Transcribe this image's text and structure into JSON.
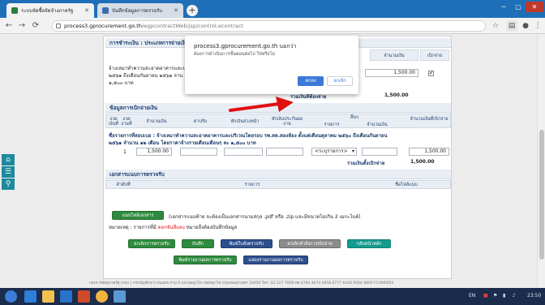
{
  "browser": {
    "tabs": [
      {
        "label": "ระบบจัดซื้อจัดจ้างภาครัฐ",
        "active": true
      },
      {
        "label": "บันทึกข้อมูลการตรวจรับ",
        "active": false
      }
    ],
    "url_host": "process3.gprocurement.go.th",
    "url_path": "/egpcontractWeb/jsp/control.econtract"
  },
  "page": {
    "top_section": {
      "title": "การชำระเงิน : ประเภทการจ่ายเงิน",
      "col_amount": "จำนวนเงิน",
      "col_select": "เบิกจ่าย",
      "row_text_1": "จ้างเหมาทำความสะอาดอาคารและบ",
      "row_text_2": "๒๕๖๑ ถึงเดือนกันยายน ๒๕๖๑ จาน",
      "row_text_3": "๑,๕๐๐ บาท",
      "row_amount": "1,500.00",
      "row_checked": "✔",
      "total_label": "รวมเงินที่ต้องจ่าย",
      "total_value": "1,500.00"
    },
    "disbursement": {
      "title": "ข้อมูลการเบิกจ่ายเงิน",
      "headers": {
        "period": "งวด เงินที่",
        "seq": "งวด งานที่",
        "amount": "จำนวนเงิน",
        "fine": "ค่าปรับ",
        "advance": "หักเงินล่วงหน้า",
        "retention": "หักเงินประกันผลงาน",
        "deduct": "อื่นๆ",
        "deduct_item": "รายการ",
        "deduct_amount": "จำนวนเงิน",
        "net": "จำนวนเงินที่เบิกจ่าย"
      },
      "desc_line_1": "ชื่อรายการที่สอบเบอ : จ้างเหมาทำความสะอาดอาคารและบริเวณโดยรอบ รพ.สต.สองห้อง ตั้งแต่เดือนตุลาคม ๒๕๖๐ ถึงเดือนกันยายน",
      "desc_line_2": "๒๕๖๑ จำนวน ๑๒ เดือน โดยราคาจ้างรายเดือนเดือนๆ ละ ๑,๕๐๐ บาท",
      "row_period": "1",
      "row_amount": "1,500.00",
      "row_select": "<ระบุรายการ>",
      "row_net": "1,500.00",
      "total_label": "รวมเงินตั้งเบิกจ่าย",
      "total_value": "1,500.00"
    },
    "attachments": {
      "title": "เอกสารแนบการตรวจรับ",
      "col_no": "ลำดับที่",
      "col_item": "รายการ",
      "col_file": "ชื่อไฟล์แนบ",
      "upload_button": "แนบไฟล์เอกสาร",
      "upload_note": "(เอกสารแนบท้าย จะต้องเป็นเอกสารนามสกุล .pdf หรือ .zip และมีขนาดไม่เกิน 2 เมกะไบต์)",
      "remark_prefix": "หมายเหตุ : รายการที่มี",
      "remark_red": "ดอกจันสีแดง",
      "remark_suffix": "หมายถึงต้องบันทึกข้อมูล"
    },
    "buttons": {
      "back": "ยกเลิกการตรวจรับ",
      "save": "บันทึก",
      "print_form": "พิมพ์ใบสั่งตรวจรับ",
      "cancel_disburse": "ยกเลิกคำสั่งการเบิกจ่าย",
      "return": "กลับหน้าหลัก",
      "print_report": "พิมพ์รายงานผลการตรวจรับ",
      "send_report": "แสดงรายงานผลการตรวจรับ"
    },
    "footer": "กองการพัสดุภาครัฐ (กพภ.) กรมบัญชีกลาง ถนนพระราม 6 แขวงพญาไท เขตพญาไท กรุงเทพมหานคร 10400 โทร. 02-127-7000 ต่อ 6784 4674 4958 6777 6438 6934 6800   FCON0003"
  },
  "dialog": {
    "host": "process3.gprocurement.go.th บอกว่า",
    "message": "ต้องการดำเนินการขั้นตอนต่อไป ใช่หรือไม่",
    "ok": "ตกลง",
    "cancel": "ยกเลิก"
  },
  "side_icons": [
    "home-icon",
    "grid-icon",
    "search-icon"
  ],
  "taskbar": {
    "lang": "EN",
    "time": "23:50"
  },
  "colors": {
    "accent_green": "#2e8b3e",
    "dialog_ok": "#3c78d8",
    "arrow_red": "#e01010",
    "section_header": "#e9eef5"
  }
}
